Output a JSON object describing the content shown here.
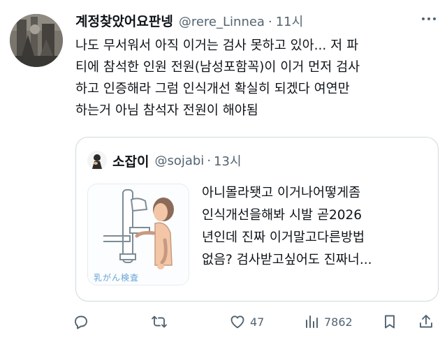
{
  "tweet": {
    "display_name": "계정찾았어요판넹",
    "handle": "@rere_Linnea",
    "separator": "·",
    "time": "11시",
    "body_lines": [
      "나도 무서워서 아직 이거는 검사 못하고 있아... 저 파",
      "티에 참석한 인원 전원(남성포함꼭)이 이거 먼저 검사",
      "하고 인증해라 그럼 인식개선 확실히 되겠다 여연만",
      "하는거 아님 참석자 전원이 해야됨"
    ]
  },
  "quote": {
    "display_name": "소잡이",
    "handle": "@sojabi",
    "separator": "·",
    "time": "13시",
    "media_caption": "乳がん検査",
    "lines": [
      "아니몰라됏고 이거나어떻게좀",
      "인식개선을해봐 시발  곧2026",
      "년인데 진짜 이거말고다른방법",
      "없음?  검사받고싶어도 진짜너..."
    ]
  },
  "actions": {
    "reply_icon": "reply-icon",
    "retweet_icon": "retweet-icon",
    "like_icon": "like-icon",
    "like_count": "47",
    "views_icon": "views-icon",
    "view_count": "7862",
    "bookmark_icon": "bookmark-icon",
    "share_icon": "share-icon"
  },
  "colors": {
    "text": "#0f1419",
    "secondary": "#536471",
    "border": "#cfd9de"
  }
}
